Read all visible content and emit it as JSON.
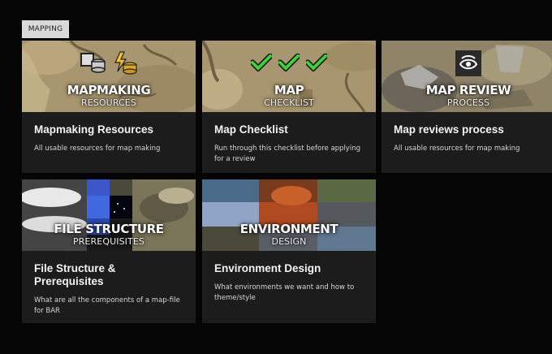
{
  "section_tag": "MAPPING",
  "cards": [
    {
      "hero_title": "MAPMAKING",
      "hero_subtitle": "RESOURCES",
      "title": "Mapmaking Resources",
      "description": "All usable resources for map making",
      "icons": [
        "stack-icon",
        "energy-coins-icon"
      ]
    },
    {
      "hero_title": "MAP",
      "hero_subtitle": "CHECKLIST",
      "title": "Map Checklist",
      "description": "Run through this checklist before applying for a review",
      "icons": [
        "check-icon",
        "check-icon",
        "check-icon"
      ]
    },
    {
      "hero_title": "MAP REVIEW",
      "hero_subtitle": "PROCESS",
      "title": "Map reviews process",
      "description": "All usable resources for map making",
      "icons": [
        "eye-icon"
      ]
    },
    {
      "hero_title": "FILE STRUCTURE",
      "hero_subtitle": "PREREQUISITES",
      "title": "File Structure & Prerequisites",
      "description": "What are all the components of a map-file for BAR",
      "icons": []
    },
    {
      "hero_title": "ENVIRONMENT",
      "hero_subtitle": "DESIGN",
      "title": "Environment Design",
      "description": "What environments we want and how to theme/style",
      "icons": []
    }
  ]
}
